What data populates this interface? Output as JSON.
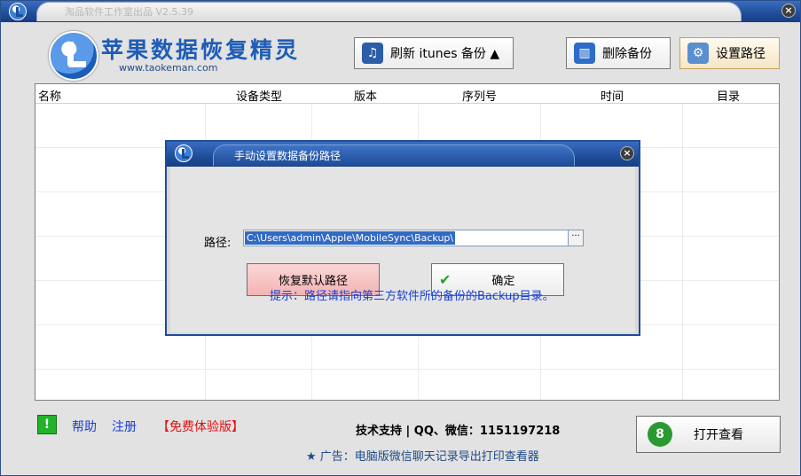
{
  "window": {
    "title": "淘品软件工作室出品 V2.5.39",
    "close": "×"
  },
  "header": {
    "app_name": "苹果数据恢复精灵",
    "site": "www.taokeman.com"
  },
  "toolbar": {
    "refresh_label": "刷新 itunes 备份 ▲",
    "delete_label": "删除备份",
    "setpath_label": "设置路径",
    "icons": [
      "music-note-icon",
      "trash-icon",
      "settings-icon"
    ]
  },
  "table": {
    "columns": [
      "名称",
      "设备类型",
      "版本",
      "序列号",
      "时间",
      "目录"
    ],
    "rows": []
  },
  "dialog": {
    "title": "手动设置数据备份路径",
    "close": "×",
    "path_label": "路径:",
    "path_value": "C:\\Users\\admin\\Apple\\MobileSync\\Backup\\",
    "browse_label": "···",
    "restore_label": "恢复默认路径",
    "ok_label": "确定",
    "hint": "提示：路径请指向第三方软件所的备份的Backup目录。",
    "colors": {
      "restore_bg": "#f6c6c6",
      "hint": "#1a3fd0",
      "check": "#22a22a"
    }
  },
  "footer": {
    "help_icon": "!",
    "help_label": "帮助",
    "register_label": "注册",
    "trial_label": "【免费体验版】",
    "support_text": "技术支持 | QQ、微信：1151197218",
    "ad_text": "★ 广告：电脑版微信聊天记录导出打印查看器",
    "open_label": "打开查看",
    "open_icon_text": "8"
  }
}
